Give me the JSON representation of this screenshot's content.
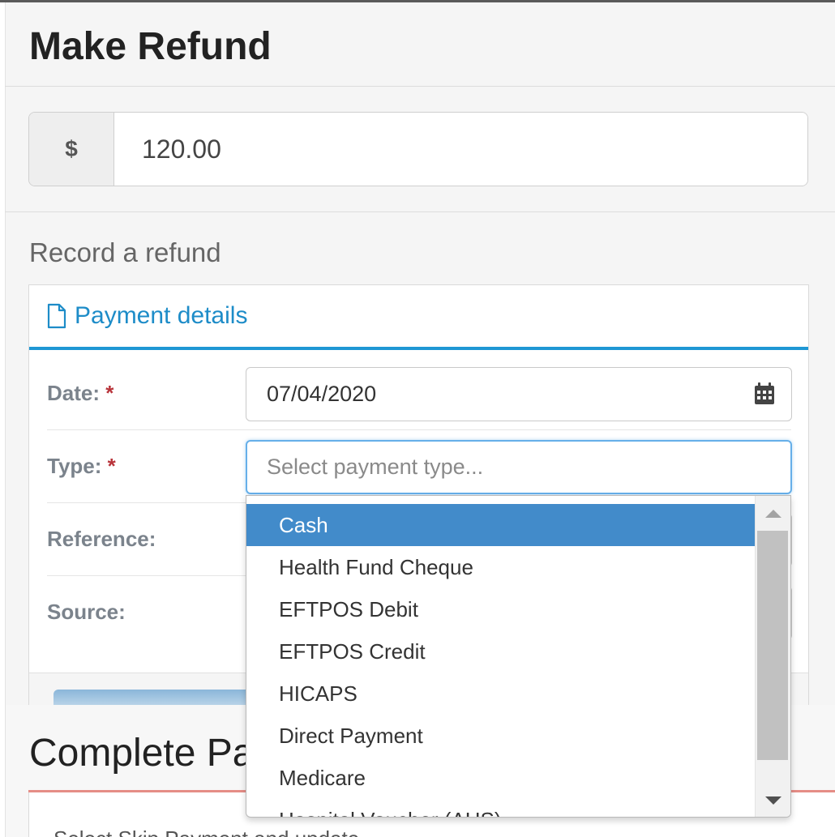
{
  "page": {
    "title": "Make Refund"
  },
  "amount": {
    "currency_symbol": "$",
    "value": "120.00"
  },
  "record": {
    "heading": "Record a refund",
    "section_title": "Payment details"
  },
  "form": {
    "date_label": "Date:",
    "date_value": "07/04/2020",
    "type_label": "Type:",
    "type_placeholder": "Select payment type...",
    "reference_label": "Reference:",
    "source_label": "Source:",
    "required_marker": "*"
  },
  "dropdown": {
    "options": [
      "Cash",
      "Health Fund Cheque",
      "EFTPOS Debit",
      "EFTPOS Credit",
      "HICAPS",
      "Direct Payment",
      "Medicare",
      "Hospital Voucher (AHS)"
    ],
    "selected_index": 0
  },
  "complete_payment": {
    "title": "Complete Payment",
    "hint": "Select Skip Payment and update"
  },
  "colors": {
    "accent": "#1f97d4",
    "selected": "#428bca",
    "required": "#b8333a",
    "complete_accent": "#e58d86"
  },
  "icons": {
    "section": "file-icon",
    "date": "calendar-icon"
  }
}
